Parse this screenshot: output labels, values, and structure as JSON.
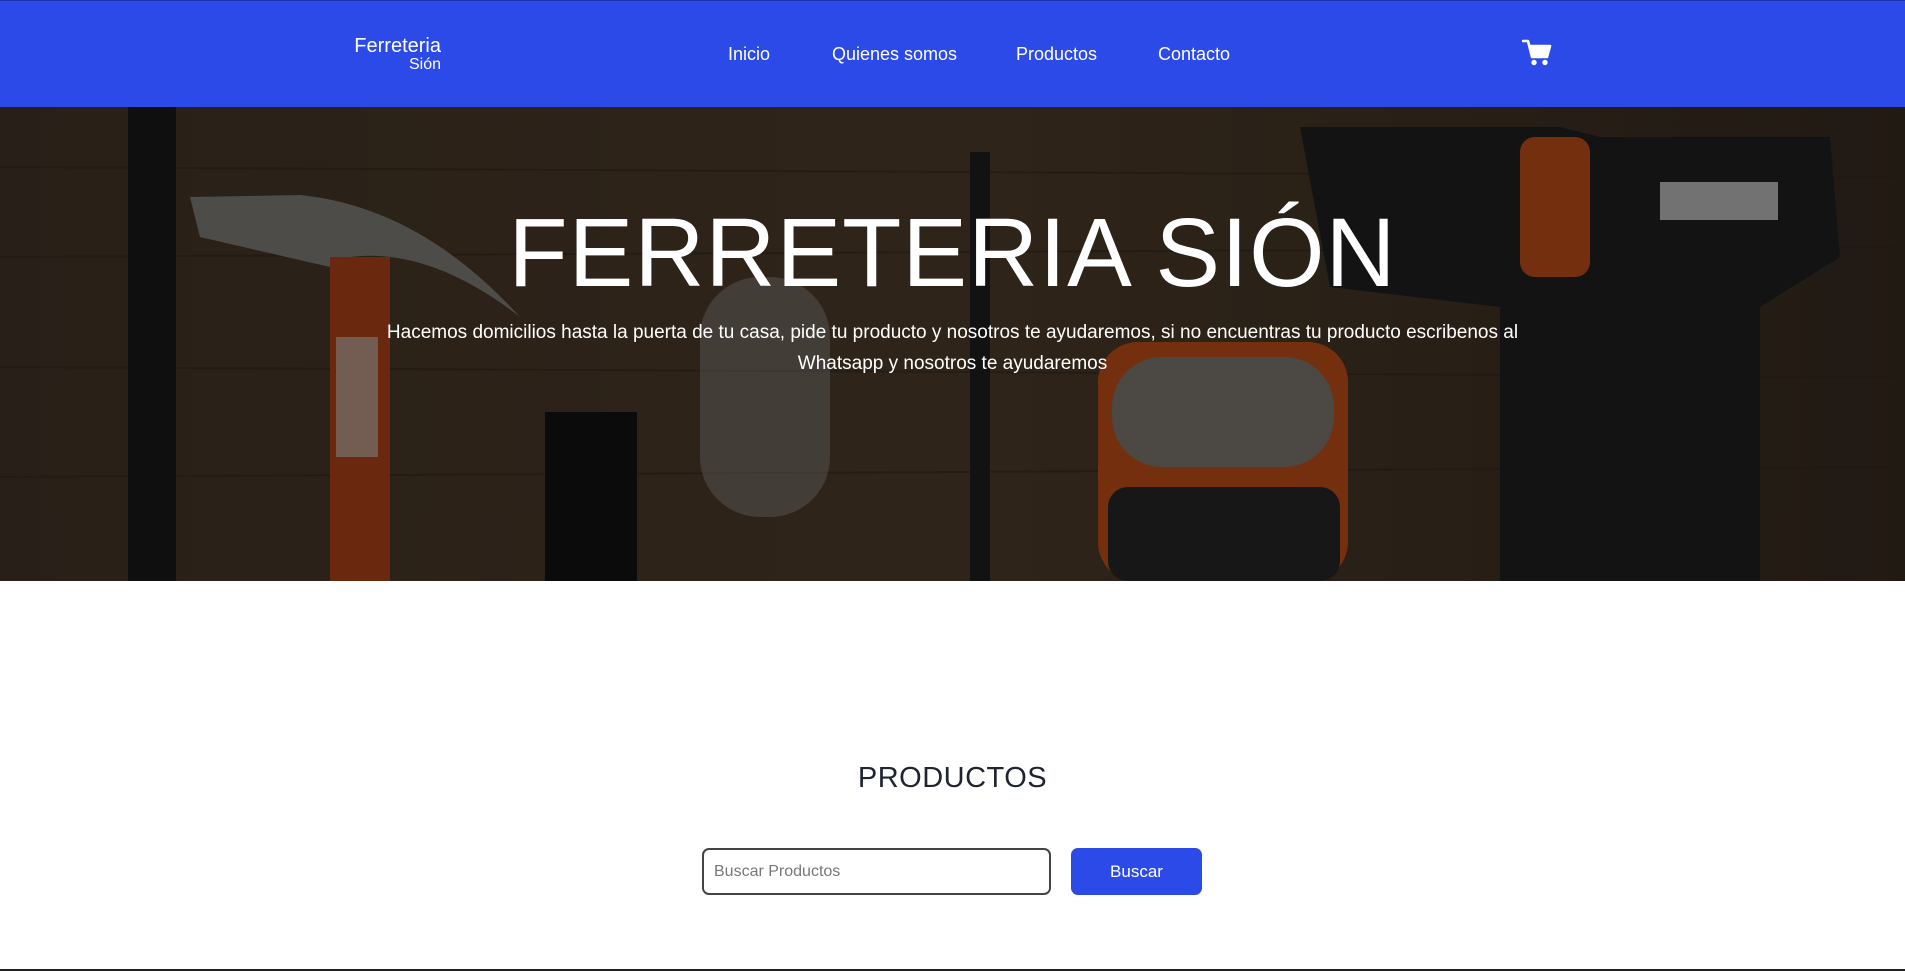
{
  "brand": {
    "line1": "Ferreteria",
    "line2": "Sión"
  },
  "nav": {
    "items": [
      {
        "label": "Inicio"
      },
      {
        "label": "Quienes somos"
      },
      {
        "label": "Productos"
      },
      {
        "label": "Contacto"
      }
    ],
    "cart_icon": "shopping-cart-icon"
  },
  "hero": {
    "title": "FERRETERIA SIÓN",
    "subtitle": "Hacemos domicilios hasta la puerta de tu casa, pide tu producto y nosotros te ayudaremos, si no encuentras tu producto escribenos al Whatsapp y nosotros te ayudaremos"
  },
  "products": {
    "title": "PRODUCTOS",
    "search_placeholder": "Buscar Productos",
    "search_value": "",
    "search_button": "Buscar"
  },
  "colors": {
    "accent": "#2b4ae8",
    "hero_overlay": "#2a1f16",
    "text_dark": "#1f2430"
  }
}
